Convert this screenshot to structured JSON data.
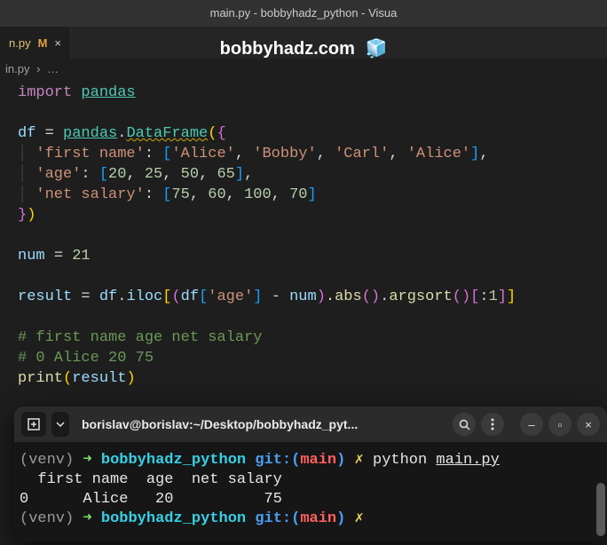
{
  "window": {
    "title": "main.py - bobbyhadz_python - Visua"
  },
  "tab": {
    "name": "n.py",
    "modified": "M",
    "close": "×"
  },
  "overlay": {
    "title": "bobbyhadz.com",
    "cube": "🧊"
  },
  "breadcrumb": {
    "file": "in.py",
    "sep": "›",
    "dots": "…"
  },
  "code": {
    "import": "import",
    "pandas": "pandas",
    "df": "df",
    "eq": "=",
    "dot": ".",
    "DataFrame": "DataFrame",
    "lp": "(",
    "rp": ")",
    "lb": "{",
    "rb": "}",
    "ls": "[",
    "rs": "]",
    "comma": ",",
    "colon": ":",
    "k_first": "'first name'",
    "k_age": "'age'",
    "k_salary": "'net salary'",
    "alice": "'Alice'",
    "bobby": "'Bobby'",
    "carl": "'Carl'",
    "alice2": "'Alice'",
    "n20": "20",
    "n25": "25",
    "n50": "50",
    "n65": "65",
    "n75": "75",
    "n60": "60",
    "n100": "100",
    "n70": "70",
    "num": "num",
    "n21": "21",
    "result": "result",
    "iloc": "iloc",
    "age": "'age'",
    "minus": "-",
    "abs": "abs",
    "argsort": "argsort",
    "slice1": "1",
    "cm1": "#   first name  age  net salary",
    "cm2": "# 0      Alice   20          75",
    "print": "print"
  },
  "terminal": {
    "header_title": "borislav@borislav:~/Desktop/bobbyhadz_pyt...",
    "venv": "(venv)",
    "arrow": "➜",
    "dir": "bobbyhadz_python",
    "git": "git:(",
    "branch": "main",
    "gitclose": ")",
    "dirty": "✗",
    "python": "python",
    "file": "main.py",
    "out1": "  first name  age  net salary",
    "out2": "0      Alice   20          75",
    "btn_minimize": "–",
    "btn_maximize": "▫",
    "btn_close": "×",
    "btn_search": "search",
    "btn_menu": "menu",
    "btn_new": "new",
    "btn_down": "down"
  }
}
